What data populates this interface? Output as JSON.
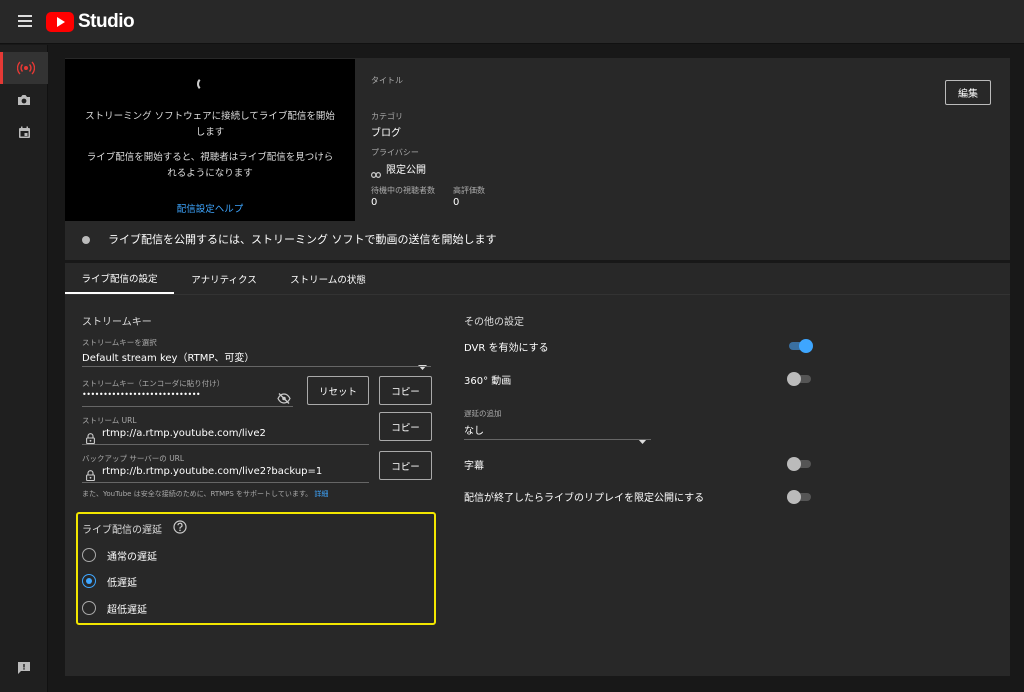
{
  "app": {
    "logo_text": "Studio",
    "menu_icon": "hamburger-menu-icon",
    "accent": "#ff0000"
  },
  "rail": [
    {
      "name": "live-icon"
    },
    {
      "name": "camera-icon"
    },
    {
      "name": "calendar-icon"
    },
    {
      "name": "feedback-icon"
    }
  ],
  "preview": {
    "line1": "ストリーミング ソフトウェアに接続してライブ配信を開始",
    "line2": "します",
    "line3": "ライブ配信を開始すると、視聴者はライブ配信を見つけら",
    "line4": "れるようになります",
    "help": "配信設定ヘルプ"
  },
  "info": {
    "title_label": "タイトル",
    "category_label": "カテゴリ",
    "category_value": "ブログ",
    "privacy_label": "プライバシー",
    "privacy_value": "限定公開",
    "waiting_label": "待機中の視聴者数",
    "waiting_value": "0",
    "likes_label": "高評価数",
    "likes_value": "0",
    "edit_button": "編集"
  },
  "status": {
    "text": "ライブ配信を公開するには、ストリーミング ソフトで動画の送信を開始します"
  },
  "tabs": [
    {
      "label": "ライブ配信の設定",
      "active": true
    },
    {
      "label": "アナリティクス",
      "active": false
    },
    {
      "label": "ストリームの状態",
      "active": false
    }
  ],
  "stream_key": {
    "section_title": "ストリームキー",
    "select_label": "ストリームキーを選択",
    "select_value": "Default stream key（RTMP、可変）",
    "key_label": "ストリームキー（エンコーダに貼り付け）",
    "key_value": "••••••••••••••••••••••••••••",
    "reset_button": "リセット",
    "copy_button": "コピー",
    "url_label": "ストリーム URL",
    "url_value": "rtmp://a.rtmp.youtube.com/live2",
    "backup_label": "バックアップ サーバーの URL",
    "backup_value": "rtmp://b.rtmp.youtube.com/live2?backup=1",
    "note": "また、YouTube は安全な接続のために、RTMPS をサポートしています。",
    "note_link": "詳細"
  },
  "latency": {
    "title": "ライブ配信の遅延",
    "options": [
      {
        "label": "通常の遅延",
        "checked": false
      },
      {
        "label": "低遅延",
        "checked": true
      },
      {
        "label": "超低遅延",
        "checked": false
      }
    ]
  },
  "other": {
    "section_title": "その他の設定",
    "dvr_label": "DVR を有効にする",
    "dvr_on": true,
    "vr_label": "360° 動画",
    "vr_on": false,
    "delay_label": "遅延の追加",
    "delay_value": "なし",
    "captions_label": "字幕",
    "captions_on": false,
    "replay_label": "配信が終了したらライブのリプレイを限定公開にする",
    "replay_on": false
  }
}
